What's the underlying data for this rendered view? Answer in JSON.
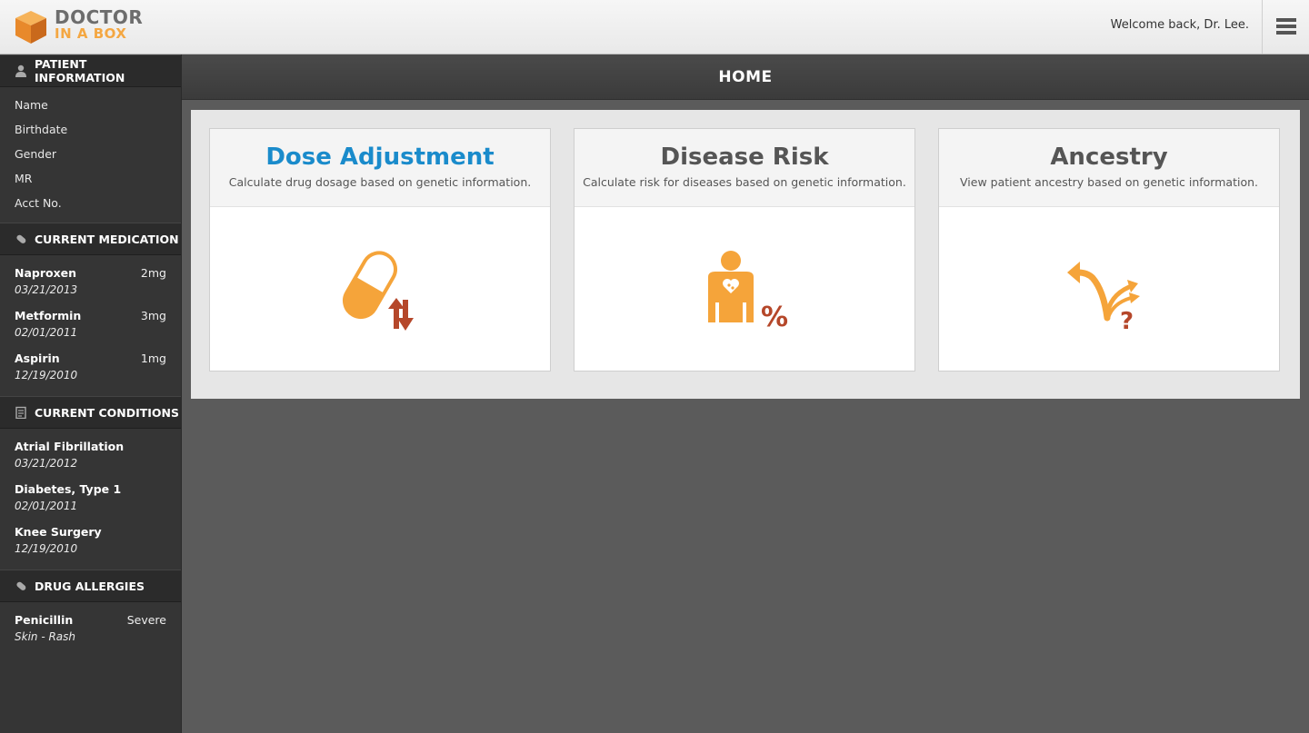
{
  "app": {
    "logo_line1": "DOCTOR",
    "logo_line2": "IN A BOX"
  },
  "header": {
    "welcome": "Welcome back, Dr. Lee."
  },
  "page": {
    "title": "HOME"
  },
  "sidebar": {
    "patient_info": {
      "heading": "PATIENT INFORMATION",
      "fields": [
        "Name",
        "Birthdate",
        "Gender",
        "MR",
        "Acct No."
      ]
    },
    "medication": {
      "heading": "CURRENT MEDICATION",
      "items": [
        {
          "name": "Naproxen",
          "dose": "2mg",
          "date": "03/21/2013"
        },
        {
          "name": "Metformin",
          "dose": "3mg",
          "date": "02/01/2011"
        },
        {
          "name": "Aspirin",
          "dose": "1mg",
          "date": "12/19/2010"
        }
      ]
    },
    "conditions": {
      "heading": "CURRENT CONDITIONS",
      "items": [
        {
          "name": "Atrial Fibrillation",
          "date": "03/21/2012"
        },
        {
          "name": "Diabetes, Type 1",
          "date": "02/01/2011"
        },
        {
          "name": "Knee Surgery",
          "date": "12/19/2010"
        }
      ]
    },
    "allergies": {
      "heading": "DRUG ALLERGIES",
      "items": [
        {
          "name": "Penicillin",
          "severity": "Severe",
          "reaction": "Skin - Rash"
        }
      ]
    }
  },
  "cards": [
    {
      "title": "Dose Adjustment",
      "desc": "Calculate drug dosage based on genetic information.",
      "icon": "pill-dose-icon"
    },
    {
      "title": "Disease Risk",
      "desc": "Calculate risk for diseases based on genetic information.",
      "icon": "person-percent-icon"
    },
    {
      "title": "Ancestry",
      "desc": "View patient ancestry based on genetic information.",
      "icon": "branching-arrows-icon"
    }
  ],
  "colors": {
    "accent_blue": "#1a8bcb",
    "icon_orange": "#f5a43a",
    "icon_red": "#b5472a",
    "sidebar_bg": "#353535"
  }
}
